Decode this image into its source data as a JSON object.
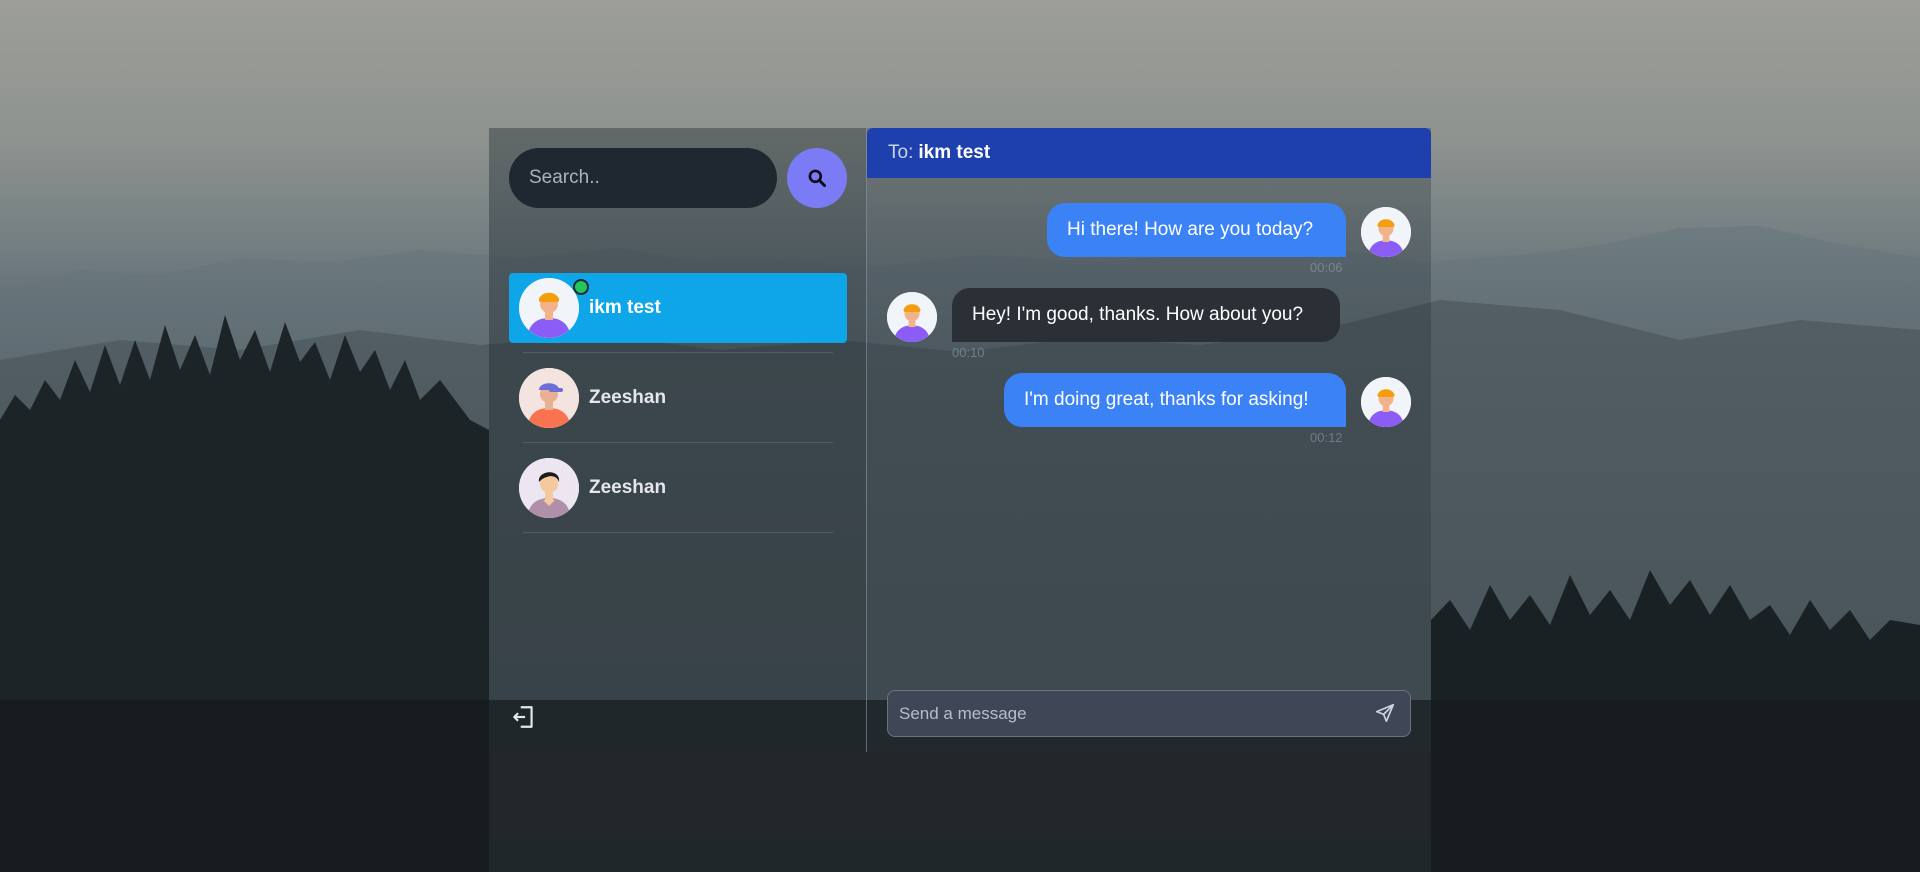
{
  "search": {
    "placeholder": "Search.."
  },
  "icons": {
    "search": "search-icon",
    "logout": "logout-icon",
    "send": "send-icon",
    "avatar": "avatar-icon"
  },
  "colors": {
    "active_conversation": "#0ea5e9",
    "chat_header": "#1e40af",
    "outgoing_bubble": "#3b82f6",
    "incoming_bubble": "#2a3036",
    "search_button": "#7b7cf5",
    "online_status": "#22c55e"
  },
  "conversations": [
    {
      "name": "ikm test",
      "active": true,
      "online": true
    },
    {
      "name": "Zeeshan",
      "active": false,
      "online": false
    },
    {
      "name": "Zeeshan",
      "active": false,
      "online": false
    }
  ],
  "chat": {
    "to_label": "To:",
    "recipient": "ikm test",
    "messages": [
      {
        "text": "Hi there! How are you today?",
        "time": "00:06",
        "direction": "outgoing"
      },
      {
        "text": "Hey! I'm good, thanks. How about you?",
        "time": "00:10",
        "direction": "incoming"
      },
      {
        "text": "I'm doing great, thanks for asking!",
        "time": "00:12",
        "direction": "outgoing"
      }
    ],
    "input_placeholder": "Send a message"
  }
}
